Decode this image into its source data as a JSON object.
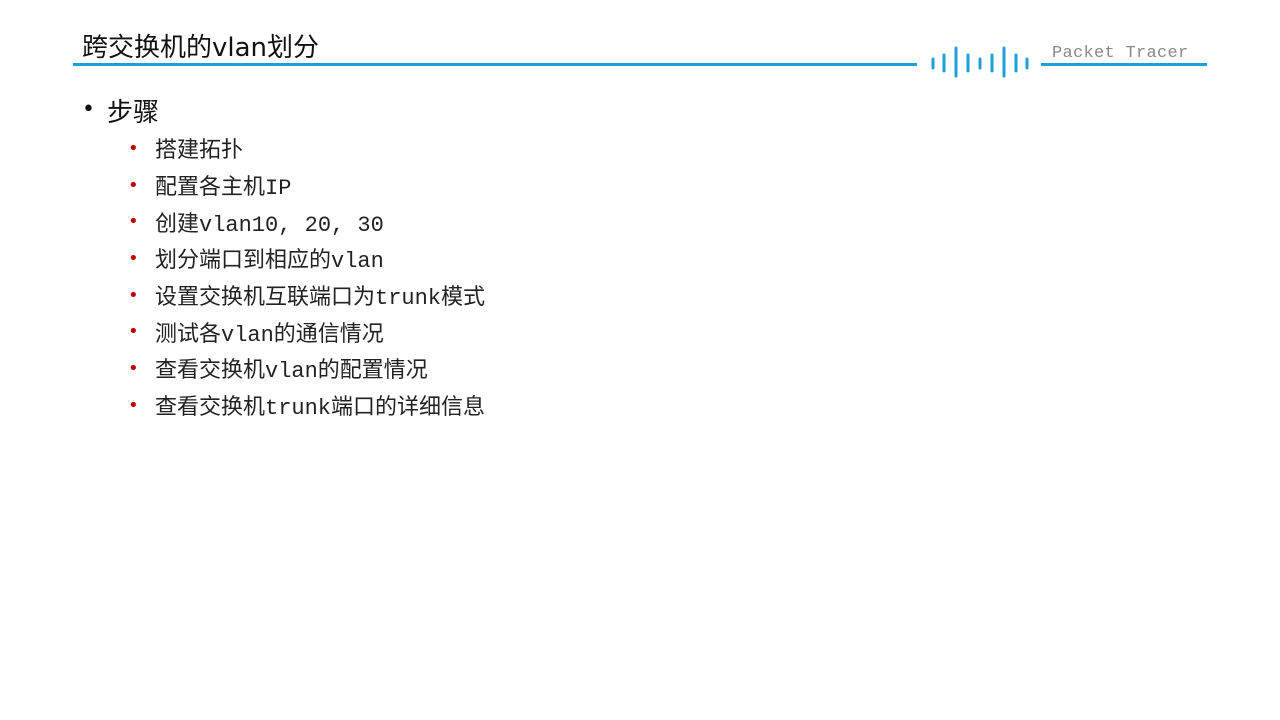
{
  "slide": {
    "title": "跨交换机的vlan划分",
    "brand": "Packet Tracer",
    "accent_color": "#1BA0D7",
    "bullet_color": "#C00000"
  },
  "content": {
    "heading": "步骤",
    "steps": [
      "搭建拓扑",
      "配置各主机IP",
      "创建vlan10, 20, 30",
      "划分端口到相应的vlan",
      "设置交换机互联端口为trunk模式",
      "测试各vlan的通信情况",
      "查看交换机vlan的配置情况",
      "查看交换机trunk端口的详细信息"
    ]
  },
  "icons": {
    "logo": "cisco-bars-logo-icon",
    "bullet_primary": "bullet-dot-icon",
    "bullet_secondary": "red-bullet-dot-icon"
  }
}
